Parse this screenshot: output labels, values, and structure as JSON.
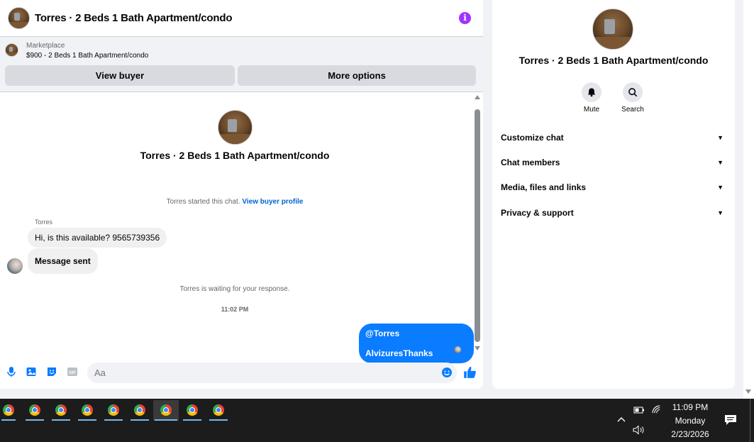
{
  "chat": {
    "header_title": "Torres · 2 Beds 1 Bath Apartment/condo",
    "info_icon": "i",
    "marketplace_label": "Marketplace",
    "listing": "$900 - 2 Beds 1 Bath Apartment/condo",
    "view_buyer": "View buyer",
    "more_options": "More options",
    "center_title": "Torres · 2 Beds 1 Bath Apartment/condo",
    "started_text": "Torres started this chat.",
    "view_buyer_profile": "View buyer profile",
    "sender_name": "Torres",
    "msg1": "Hi, is this available? 9565739356",
    "msg2": "Message sent",
    "waiting_text": "Torres is waiting for your response.",
    "timestamp": "11:02 PM",
    "out_msg": "@Torres AlvizuresThanks",
    "input_placeholder": "Aa",
    "accent_color": "#0a7cff"
  },
  "details": {
    "title": "Torres · 2 Beds 1 Bath Apartment/condo",
    "mute_label": "Mute",
    "search_label": "Search",
    "sections": [
      "Customize chat",
      "Chat members",
      "Media, files and links",
      "Privacy & support"
    ]
  },
  "taskbar": {
    "time": "11:09 PM",
    "day": "Monday",
    "date": "2/23/2026"
  }
}
